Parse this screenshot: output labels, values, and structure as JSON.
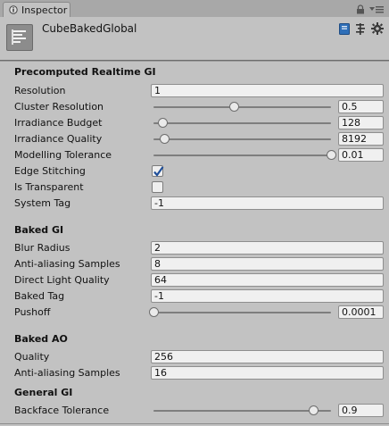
{
  "window": {
    "tab_label": "Inspector"
  },
  "header": {
    "object_name": "CubeBakedGlobal"
  },
  "sections": {
    "precomputed": {
      "title": "Precomputed Realtime GI",
      "resolution": {
        "label": "Resolution",
        "value": "1"
      },
      "cluster_resolution": {
        "label": "Cluster Resolution",
        "value": "0.5",
        "slider_fraction": 0.45
      },
      "irradiance_budget": {
        "label": "Irradiance Budget",
        "value": "128",
        "slider_fraction": 0.05
      },
      "irradiance_quality": {
        "label": "Irradiance Quality",
        "value": "8192",
        "slider_fraction": 0.06
      },
      "modelling_tolerance": {
        "label": "Modelling Tolerance",
        "value": "0.01",
        "slider_fraction": 1.0
      },
      "edge_stitching": {
        "label": "Edge Stitching",
        "checked": true
      },
      "is_transparent": {
        "label": "Is Transparent",
        "checked": false
      },
      "system_tag": {
        "label": "System Tag",
        "value": "-1"
      }
    },
    "baked": {
      "title": "Baked GI",
      "blur_radius": {
        "label": "Blur Radius",
        "value": "2"
      },
      "aa_samples": {
        "label": "Anti-aliasing Samples",
        "value": "8"
      },
      "direct_light_quality": {
        "label": "Direct Light Quality",
        "value": "64"
      },
      "baked_tag": {
        "label": "Baked Tag",
        "value": "-1"
      },
      "pushoff": {
        "label": "Pushoff",
        "value": "0.0001",
        "slider_fraction": 0.0
      }
    },
    "baked_ao": {
      "title": "Baked AO",
      "quality": {
        "label": "Quality",
        "value": "256"
      },
      "aa_samples": {
        "label": "Anti-aliasing Samples",
        "value": "16"
      }
    },
    "general": {
      "title": "General GI",
      "backface_tolerance": {
        "label": "Backface Tolerance",
        "value": "0.9",
        "slider_fraction": 0.9
      }
    }
  },
  "colors": {
    "checkbox_accent": "#1f4f9a",
    "panel_bg": "#c2c2c2"
  },
  "icons": [
    "inspector-icon",
    "lock-icon",
    "menu-icon",
    "object-icon",
    "help-book-icon",
    "preset-icon",
    "gear-icon"
  ]
}
